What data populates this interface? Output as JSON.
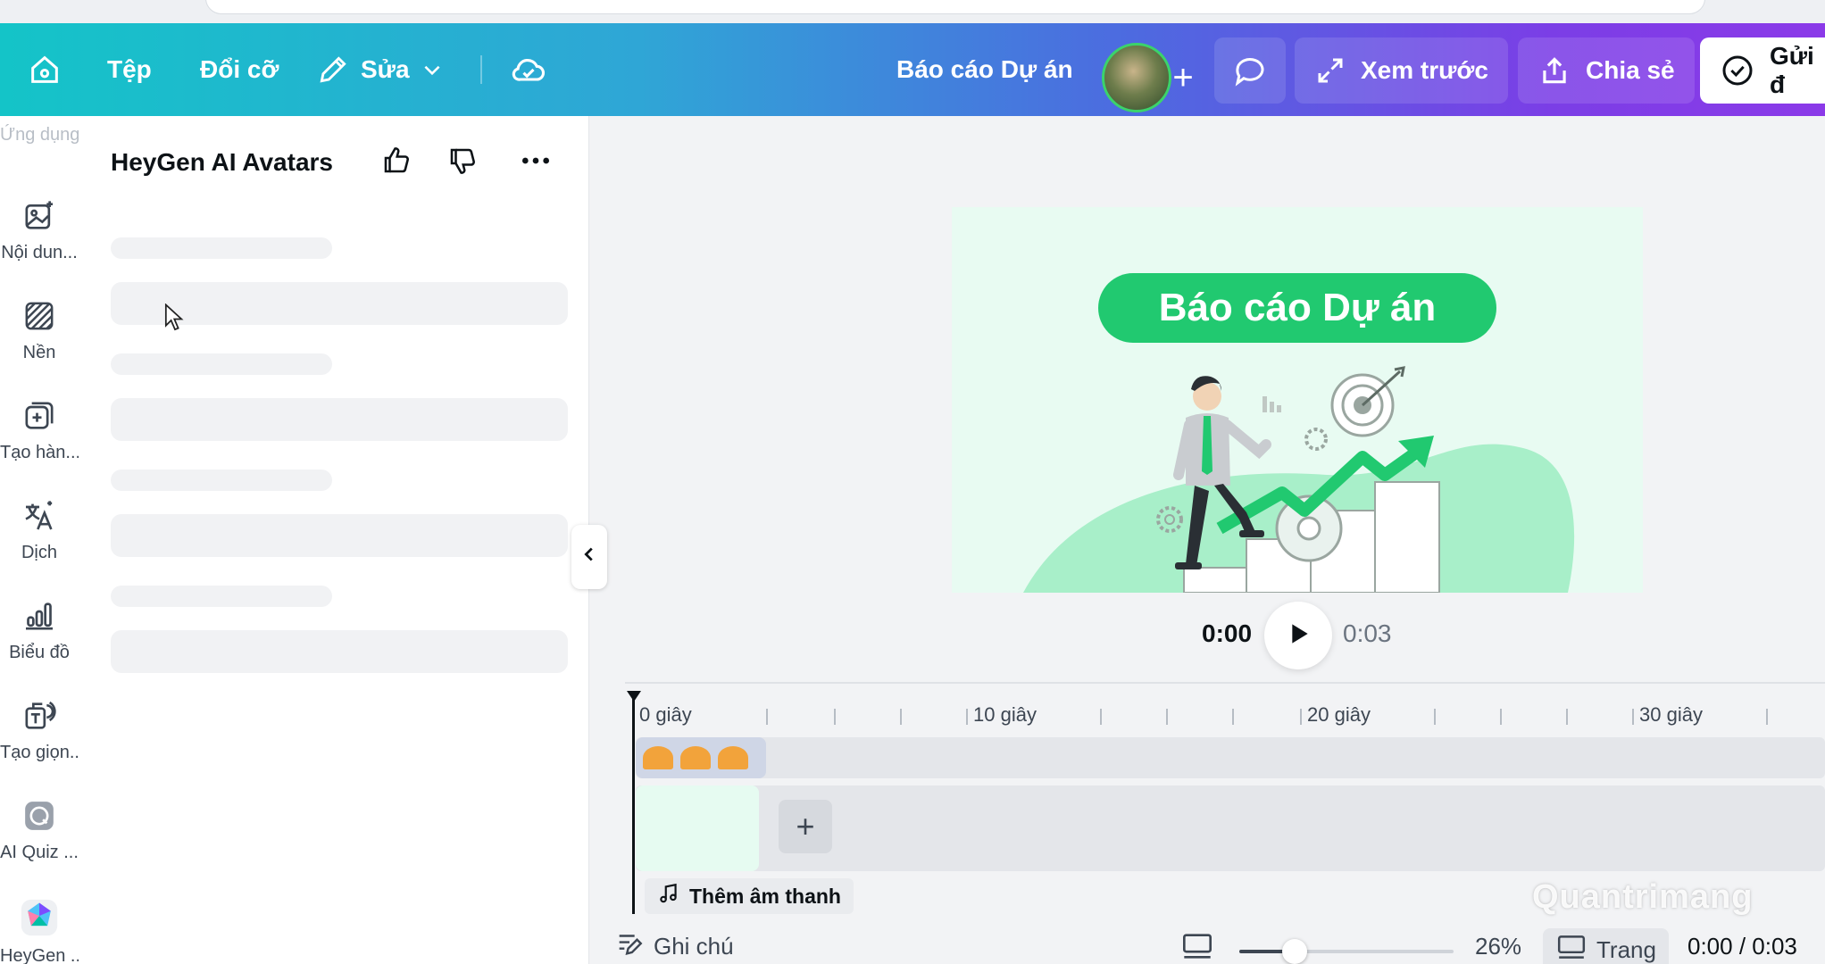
{
  "topbar": {
    "home_icon": "home-icon",
    "file_label": "Tệp",
    "resize_label": "Đổi cỡ",
    "edit_label": "Sửa",
    "edit_icon": "pencil-icon",
    "cloud_icon": "cloud-check-icon",
    "project_title": "Báo cáo Dự án",
    "add_people_label": "+",
    "comment_icon": "comment-icon",
    "preview_label": "Xem trước",
    "share_label": "Chia sẻ",
    "submit_label": "Gửi đ"
  },
  "rail": {
    "items": [
      {
        "label": "Ứng dụng",
        "icon": "apps-icon"
      },
      {
        "label": "Nội dun...",
        "icon": "magic-image-icon"
      },
      {
        "label": "Nền",
        "icon": "background-icon"
      },
      {
        "label": "Tạo hàn...",
        "icon": "add-element-icon"
      },
      {
        "label": "Dịch",
        "icon": "translate-icon"
      },
      {
        "label": "Biểu đồ",
        "icon": "chart-icon"
      },
      {
        "label": "Tạo giọn...",
        "icon": "voice-icon"
      },
      {
        "label": "AI Quiz ...",
        "icon": "quiz-icon"
      },
      {
        "label": "HeyGen ...",
        "icon": "heygen-icon"
      }
    ]
  },
  "panel": {
    "title": "HeyGen AI Avatars",
    "like_icon": "thumbs-up-icon",
    "dislike_icon": "thumbs-down-icon",
    "more_icon": "more-icon"
  },
  "canvas": {
    "slide_title": "Báo cáo Dự án",
    "background_color": "#e8fbf2",
    "accent_color": "#21c970"
  },
  "playback": {
    "current_time": "0:00",
    "total_time": "0:03"
  },
  "timeline": {
    "tick_labels": [
      "0 giây",
      "10 giây",
      "20 giây",
      "30 giây"
    ],
    "add_audio_label": "Thêm âm thanh"
  },
  "bottombar": {
    "notes_label": "Ghi chú",
    "zoom_value": "26%",
    "zoom_fraction": 0.26,
    "pages_label": "Trang",
    "time_readout": "0:00 / 0:03"
  },
  "watermark": "Quantrimang"
}
